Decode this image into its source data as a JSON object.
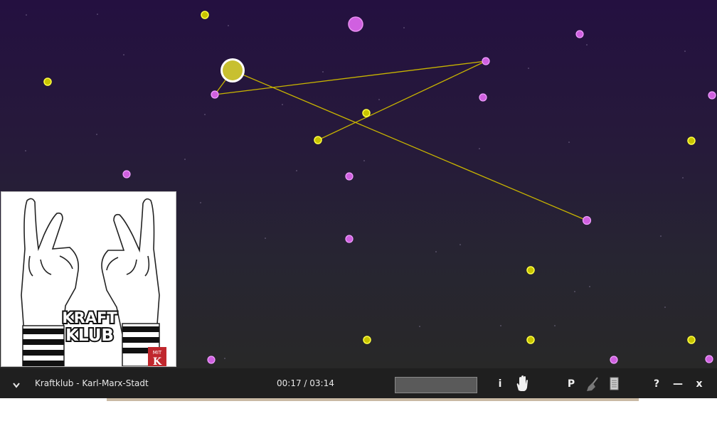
{
  "player": {
    "track_title": "Kraftklub - Karl-Marx-Stadt",
    "time": "00:17 / 03:14",
    "info_label": "i",
    "playlist_label": "P",
    "help_label": "?",
    "minimize_label": "—",
    "close_label": "x",
    "collapse_icon": "chevron-down-icon"
  },
  "album": {
    "artist_text": "KRAFT KLUB",
    "badge_text": "MIT K"
  },
  "colors": {
    "bg_top": "#241040",
    "bg_bottom": "#282828",
    "yellow_node": "#e4e000",
    "pink_node": "#d060e0",
    "line": "#c8b400",
    "bar": "#1f1f1f"
  }
}
